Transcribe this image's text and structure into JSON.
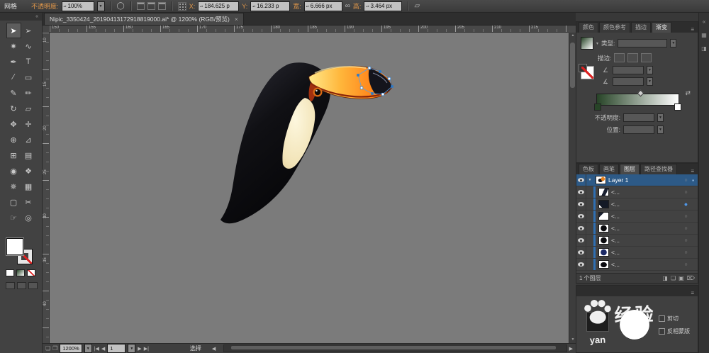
{
  "colors": {
    "accent": "#2e79c7",
    "canvas_bg": "#7b7b7b",
    "selection_row": "#2d5a87",
    "gradient_start": "#274427",
    "gradient_end": "#ffffff",
    "beak_orange": "#ff8a1e"
  },
  "control_bar": {
    "mode_label": "网格",
    "opacity_label": "不透明度:",
    "opacity_value": "100%",
    "x_label": "X:",
    "x_value": "184.625 p",
    "y_label": "Y:",
    "y_value": "16.233 p",
    "width_label": "宽:",
    "width_value": "6.666 px",
    "height_label": "高:",
    "height_value": "3.464 px",
    "icons": {
      "style_circle": "◯",
      "link_dimensions": "∞",
      "shear": "▱"
    }
  },
  "document_tab": {
    "title": "Nipic_3350424_20190413172918819000.ai* @ 1200% (RGB/预览)",
    "close_glyph": "×"
  },
  "toolbar": {
    "collapse_glyph": "«",
    "tools": [
      {
        "name": "selection-tool",
        "glyph": "➤",
        "active": true
      },
      {
        "name": "direct-selection-tool",
        "glyph": "➢"
      },
      {
        "name": "magic-wand-tool",
        "glyph": "✷"
      },
      {
        "name": "lasso-tool",
        "glyph": "∿"
      },
      {
        "name": "pen-tool",
        "glyph": "✒"
      },
      {
        "name": "type-tool",
        "glyph": "T"
      },
      {
        "name": "line-tool",
        "glyph": "∕"
      },
      {
        "name": "rectangle-tool",
        "glyph": "▭"
      },
      {
        "name": "paintbrush-tool",
        "glyph": "✎"
      },
      {
        "name": "pencil-tool",
        "glyph": "✏"
      },
      {
        "name": "rotate-tool",
        "glyph": "↻"
      },
      {
        "name": "scale-tool",
        "glyph": "▱"
      },
      {
        "name": "width-tool",
        "glyph": "✥"
      },
      {
        "name": "free-transform-tool",
        "glyph": "✛"
      },
      {
        "name": "shape-builder-tool",
        "glyph": "⊕"
      },
      {
        "name": "perspective-grid-tool",
        "glyph": "⊿"
      },
      {
        "name": "mesh-tool",
        "glyph": "⊞"
      },
      {
        "name": "gradient-tool",
        "glyph": "▤"
      },
      {
        "name": "eyedropper-tool",
        "glyph": "◉"
      },
      {
        "name": "blend-tool",
        "glyph": "❖"
      },
      {
        "name": "symbol-sprayer-tool",
        "glyph": "✵"
      },
      {
        "name": "column-graph-tool",
        "glyph": "▦"
      },
      {
        "name": "artboard-tool",
        "glyph": "▢"
      },
      {
        "name": "slice-tool",
        "glyph": "✂"
      },
      {
        "name": "hand-tool",
        "glyph": "☞"
      },
      {
        "name": "zoom-tool",
        "glyph": "◎"
      }
    ]
  },
  "rulers": {
    "top_labels": [
      "150",
      "155",
      "160",
      "165",
      "170",
      "175",
      "180",
      "185",
      "190",
      "195",
      "200",
      "205",
      "210",
      "215"
    ],
    "left_labels": [
      "10",
      "15",
      "20",
      "25",
      "30",
      "35",
      "40"
    ]
  },
  "status_bar": {
    "zoom": "1200%",
    "nav": {
      "first": "|◀",
      "prev": "◀",
      "next": "▶",
      "last": "▶|"
    },
    "page_value": "1",
    "tool_status": "选择"
  },
  "panels": {
    "gradient": {
      "tabs": [
        "颜色",
        "颜色参考",
        "描边",
        "渐变"
      ],
      "active_index": 3,
      "menu_glyph": "≡",
      "type_label": "类型:",
      "stroke_label": "描边:",
      "angle_icon": "∠",
      "aspect_icon": "∡",
      "reverse_icon": "⇄",
      "opacity_label": "不透明度:",
      "location_label": "位置:"
    },
    "layers": {
      "tabs": [
        "色板",
        "画笔",
        "图层",
        "路径查找器"
      ],
      "active_index": 2,
      "menu_glyph": "≡",
      "rows": [
        {
          "label": "Layer 1",
          "kind": "layer",
          "thumb": "toucan",
          "selected": true
        },
        {
          "label": "<...",
          "kind": "path",
          "thumb": "beak"
        },
        {
          "label": "<...",
          "kind": "path",
          "thumb": "dark",
          "targeted": true
        },
        {
          "label": "<...",
          "kind": "path",
          "thumb": "swoosh"
        },
        {
          "label": "<...",
          "kind": "path",
          "thumb": "circle"
        },
        {
          "label": "<...",
          "kind": "path",
          "thumb": "circle"
        },
        {
          "label": "<...",
          "kind": "path",
          "thumb": "circle-navy"
        },
        {
          "label": "<...",
          "kind": "path",
          "thumb": "body"
        }
      ],
      "footer_count": "1 个图层",
      "footer_icons": [
        {
          "name": "make-clip-mask-button",
          "glyph": "◨"
        },
        {
          "name": "new-sublayer-button",
          "glyph": "❏"
        },
        {
          "name": "new-layer-button",
          "glyph": "▣"
        },
        {
          "name": "delete-layer-button",
          "glyph": "⌦"
        }
      ]
    },
    "transparency": {
      "menu_glyph": "≡",
      "clip_label": "剪切",
      "invert_mask_label": "反相蒙版"
    }
  },
  "dock_strip": {
    "icons": [
      {
        "name": "collapse-dock-icon",
        "glyph": "«"
      },
      {
        "name": "panel-dock-icon-1",
        "glyph": "▦"
      },
      {
        "name": "panel-dock-icon-2",
        "glyph": "◨"
      }
    ]
  },
  "watermark": {
    "brand": "经验",
    "partial": "yan"
  }
}
